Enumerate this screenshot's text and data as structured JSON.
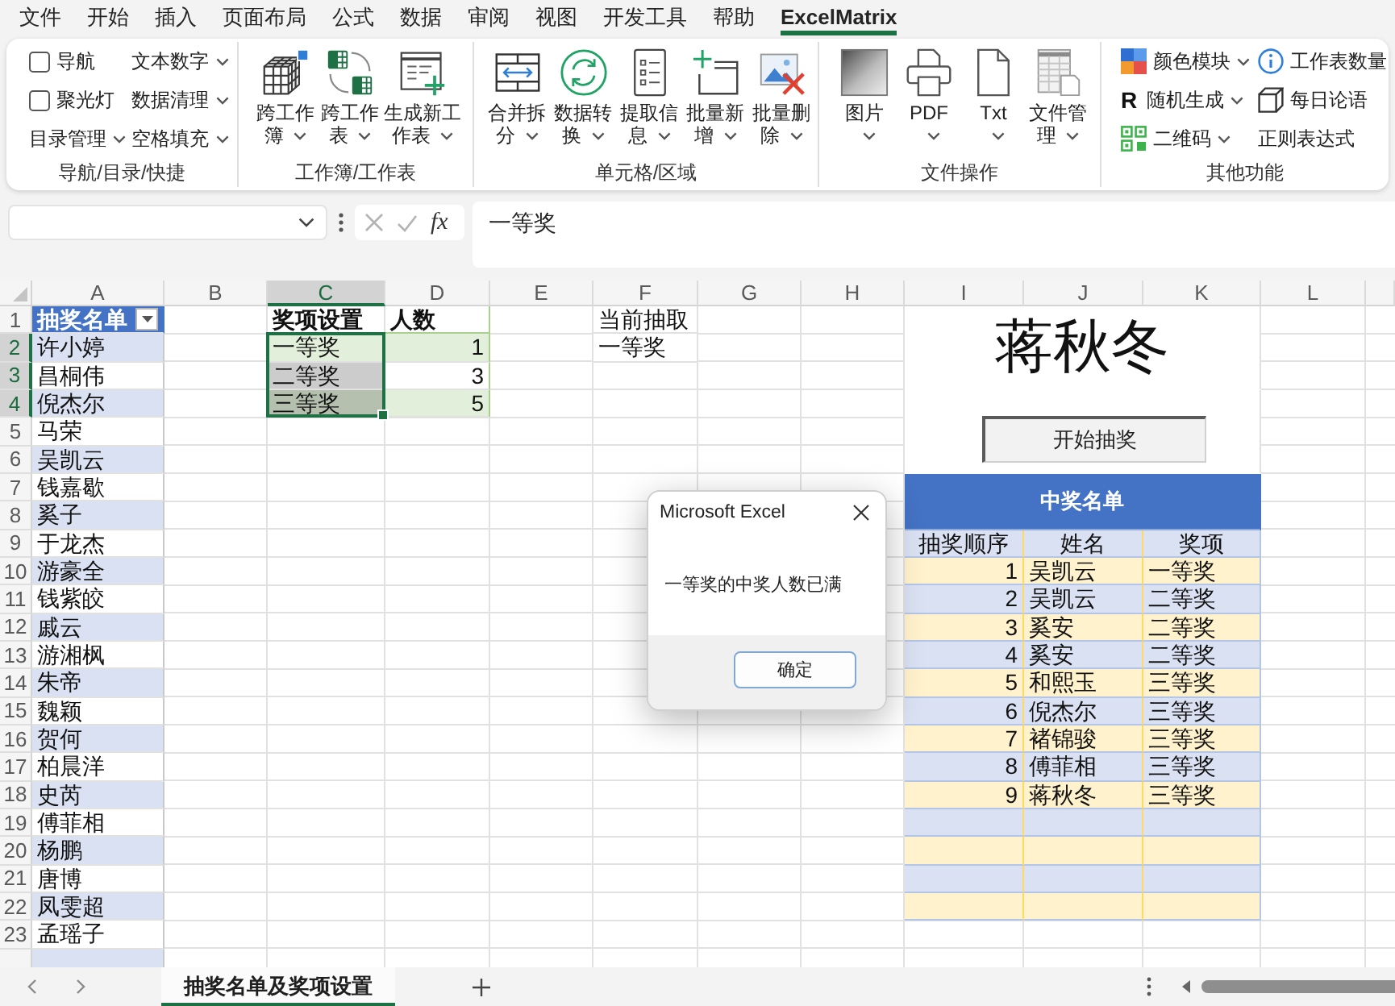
{
  "menu_tabs": [
    {
      "label": "文件",
      "selected": false
    },
    {
      "label": "开始",
      "selected": false
    },
    {
      "label": "插入",
      "selected": false
    },
    {
      "label": "页面布局",
      "selected": false
    },
    {
      "label": "公式",
      "selected": false
    },
    {
      "label": "数据",
      "selected": false
    },
    {
      "label": "审阅",
      "selected": false
    },
    {
      "label": "视图",
      "selected": false
    },
    {
      "label": "开发工具",
      "selected": false
    },
    {
      "label": "帮助",
      "selected": false
    },
    {
      "label": "ExcelMatrix",
      "selected": true
    }
  ],
  "ribbon": {
    "groups": [
      {
        "kind": "small",
        "label": "导航/目录/快捷",
        "columns": [
          [
            {
              "kind": "checkbox",
              "label": "导航",
              "checked": false
            },
            {
              "kind": "checkbox",
              "label": "聚光灯",
              "checked": false
            },
            {
              "kind": "button",
              "label": "目录管理",
              "dropdown": true
            }
          ],
          [
            {
              "kind": "button",
              "label": "文本数字",
              "dropdown": true
            },
            {
              "kind": "button",
              "label": "数据清理",
              "dropdown": true
            },
            {
              "kind": "button",
              "label": "空格填充",
              "dropdown": true
            }
          ]
        ]
      },
      {
        "kind": "large",
        "label": "工作簿/工作表",
        "buttons": [
          {
            "label": "跨工作簿",
            "dropdown": true
          },
          {
            "label": "跨工作表",
            "dropdown": true
          },
          {
            "label": "生成新工作表",
            "dropdown": true
          }
        ]
      },
      {
        "kind": "large",
        "label": "单元格/区域",
        "buttons": [
          {
            "label": "合并拆分",
            "dropdown": true
          },
          {
            "label": "数据转换",
            "dropdown": true
          },
          {
            "label": "提取信息",
            "dropdown": true
          },
          {
            "label": "批量新增",
            "dropdown": true
          },
          {
            "label": "批量删除",
            "dropdown": true
          }
        ]
      },
      {
        "kind": "large",
        "label": "文件操作",
        "buttons": [
          {
            "label": "图片",
            "dropdown": true
          },
          {
            "label": "PDF",
            "dropdown": true
          },
          {
            "label": "Txt",
            "dropdown": true
          },
          {
            "label": "文件管理",
            "dropdown": true
          }
        ]
      },
      {
        "kind": "small",
        "label": "其他功能",
        "columns": [
          [
            {
              "kind": "button",
              "label": "颜色模块",
              "dropdown": true
            },
            {
              "kind": "button",
              "glyph": "R",
              "label": "随机生成",
              "dropdown": true
            },
            {
              "kind": "button",
              "label": "二维码",
              "dropdown": true
            }
          ],
          [
            {
              "kind": "button",
              "label": "工作表数量",
              "dropdown": false
            },
            {
              "kind": "button",
              "label": "每日论语",
              "dropdown": false
            },
            {
              "kind": "button",
              "label": "正则表达式",
              "dropdown": false
            }
          ]
        ]
      }
    ]
  },
  "formula_bar": {
    "function_label": "fx",
    "value": "一等奖"
  },
  "sheet": {
    "columns": [
      {
        "label": "A",
        "selected": false
      },
      {
        "label": "B",
        "selected": false
      },
      {
        "label": "C",
        "selected": true
      },
      {
        "label": "D",
        "selected": false
      },
      {
        "label": "E",
        "selected": false
      },
      {
        "label": "F",
        "selected": false
      },
      {
        "label": "G",
        "selected": false
      },
      {
        "label": "H",
        "selected": false
      },
      {
        "label": "I",
        "selected": false
      },
      {
        "label": "J",
        "selected": false
      },
      {
        "label": "K",
        "selected": false
      },
      {
        "label": "L",
        "selected": false
      }
    ],
    "rows": [
      {
        "label": "1",
        "selected": false
      },
      {
        "label": "2",
        "selected": true
      },
      {
        "label": "3",
        "selected": true
      },
      {
        "label": "4",
        "selected": true
      },
      {
        "label": "5",
        "selected": false
      },
      {
        "label": "6",
        "selected": false
      },
      {
        "label": "7",
        "selected": false
      },
      {
        "label": "8",
        "selected": false
      },
      {
        "label": "9",
        "selected": false
      },
      {
        "label": "10",
        "selected": false
      },
      {
        "label": "11",
        "selected": false
      },
      {
        "label": "12",
        "selected": false
      },
      {
        "label": "13",
        "selected": false
      },
      {
        "label": "14",
        "selected": false
      },
      {
        "label": "15",
        "selected": false
      },
      {
        "label": "16",
        "selected": false
      },
      {
        "label": "17",
        "selected": false
      },
      {
        "label": "18",
        "selected": false
      },
      {
        "label": "19",
        "selected": false
      },
      {
        "label": "20",
        "selected": false
      },
      {
        "label": "21",
        "selected": false
      },
      {
        "label": "22",
        "selected": false
      },
      {
        "label": "23",
        "selected": false
      }
    ],
    "name_list": {
      "header": "抽奖名单",
      "names": [
        "许小婷",
        "昌桐伟",
        "倪杰尔",
        "马荣",
        "吴凯云",
        "钱嘉歇",
        "奚子",
        "于龙杰",
        "游豪全",
        "钱紫皎",
        "戚云",
        "游湘枫",
        "朱帝",
        "魏颖",
        "贺何",
        "柏晨洋",
        "史芮",
        "傅菲相",
        "杨鹏",
        "唐博",
        "凤雯超",
        "孟瑶子"
      ]
    },
    "prize_settings": {
      "headers": [
        "奖项设置",
        "人数"
      ],
      "rows": [
        {
          "prize": "一等奖",
          "count": "1",
          "selected": true,
          "active": true
        },
        {
          "prize": "二等奖",
          "count": "3",
          "selected": true,
          "active": false
        },
        {
          "prize": "三等奖",
          "count": "5",
          "selected": true,
          "active": false
        }
      ]
    },
    "current_draw": {
      "label": "当前抽取",
      "value": "一等奖"
    },
    "draw_panel": {
      "name": "蒋秋冬",
      "button": "开始抽奖"
    },
    "winners": {
      "title": "中奖名单",
      "columns": [
        "抽奖顺序",
        "姓名",
        "奖项"
      ],
      "rows": [
        {
          "order": "1",
          "name": "吴凯云",
          "prize": "一等奖"
        },
        {
          "order": "2",
          "name": "吴凯云",
          "prize": "二等奖"
        },
        {
          "order": "3",
          "name": "奚安",
          "prize": "二等奖"
        },
        {
          "order": "4",
          "name": "奚安",
          "prize": "二等奖"
        },
        {
          "order": "5",
          "name": "和熙玉",
          "prize": "三等奖"
        },
        {
          "order": "6",
          "name": "倪杰尔",
          "prize": "三等奖"
        },
        {
          "order": "7",
          "name": "褚锦骏",
          "prize": "三等奖"
        },
        {
          "order": "8",
          "name": "傅菲相",
          "prize": "三等奖"
        },
        {
          "order": "9",
          "name": "蒋秋冬",
          "prize": "三等奖"
        }
      ]
    }
  },
  "dialog": {
    "title": "Microsoft Excel",
    "message": "一等奖的中奖人数已满",
    "button": "确定"
  },
  "sheet_tabs": [
    {
      "label": "抽奖名单及奖项设置",
      "selected": true
    }
  ]
}
